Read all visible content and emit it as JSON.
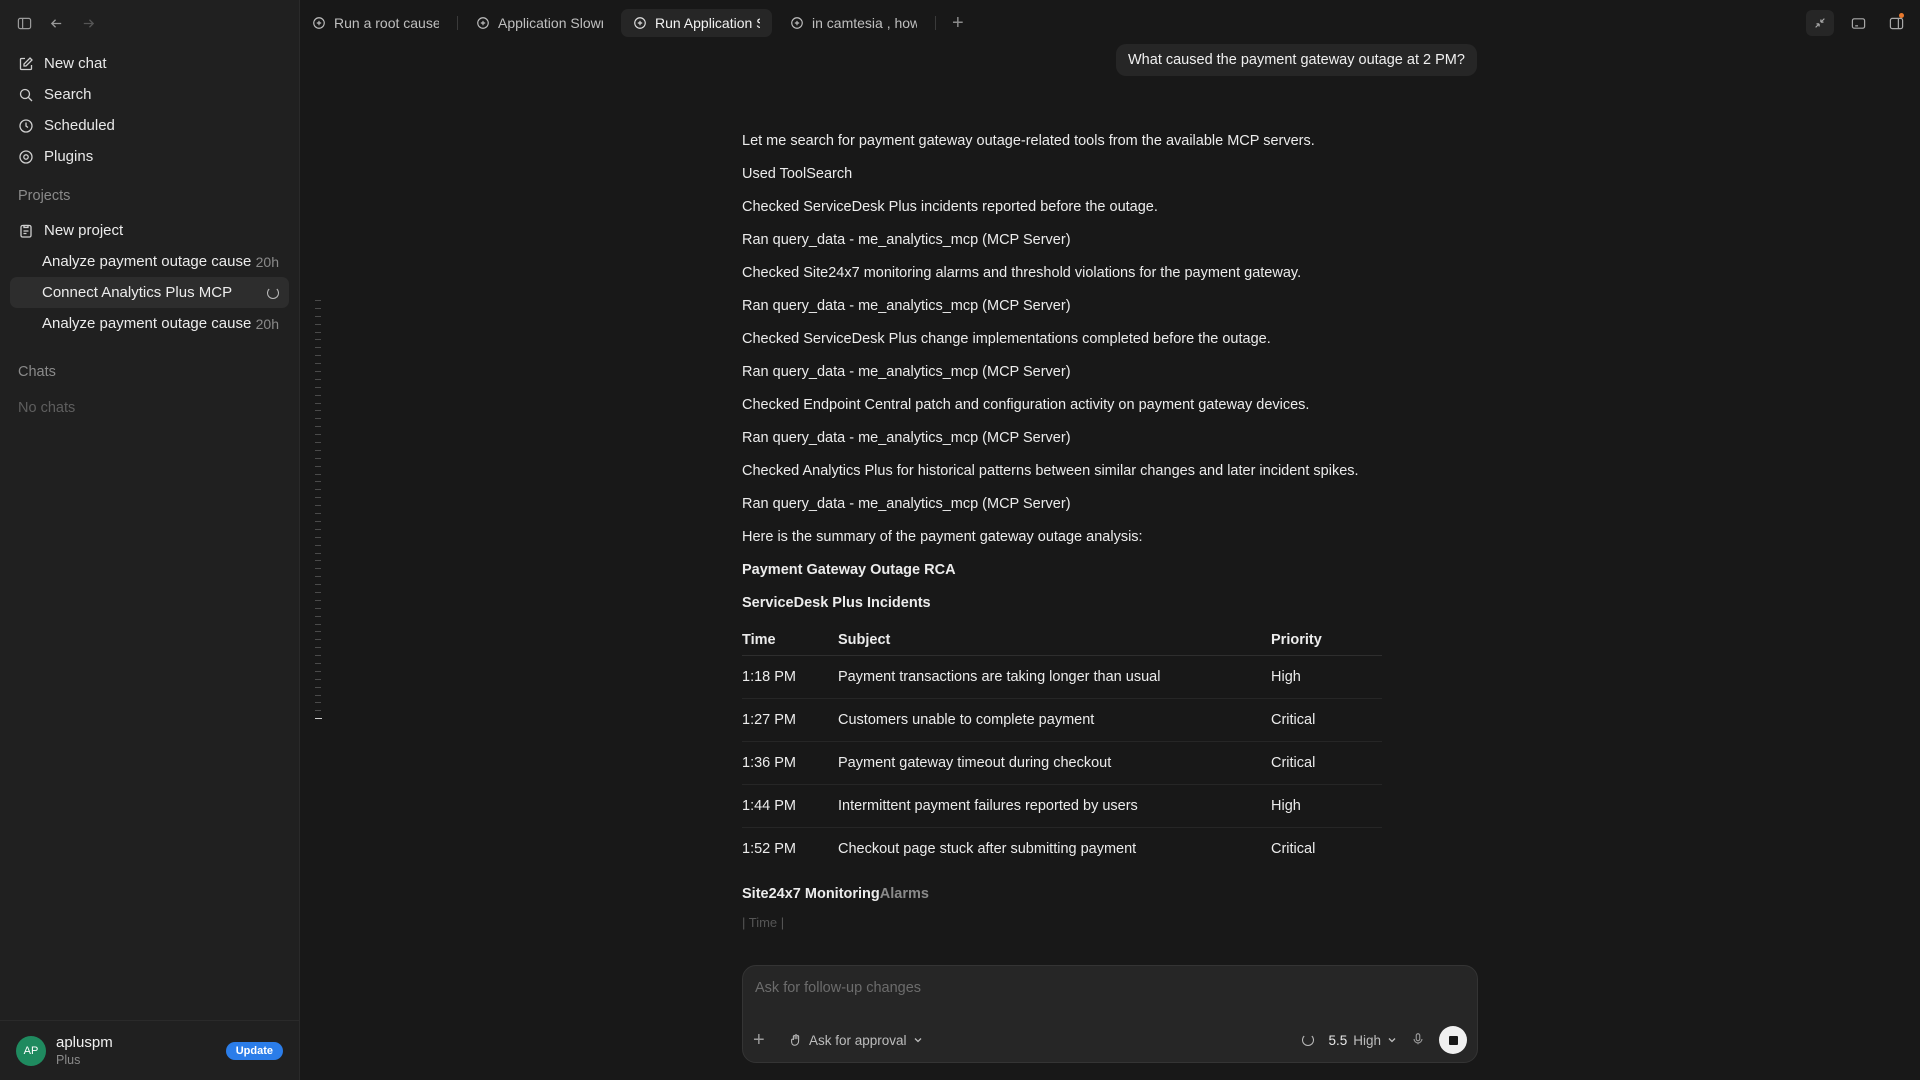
{
  "sidebar": {
    "nav": [
      {
        "label": "New chat",
        "icon": "edit-icon"
      },
      {
        "label": "Search",
        "icon": "search-icon"
      },
      {
        "label": "Scheduled",
        "icon": "clock-icon"
      },
      {
        "label": "Plugins",
        "icon": "plugin-icon"
      }
    ],
    "projects_label": "Projects",
    "new_project": "New project",
    "projects": [
      {
        "label": "Analyze payment outage cause",
        "age": "20h"
      },
      {
        "label": "Connect Analytics Plus MCP",
        "age": ""
      },
      {
        "label": "Analyze payment outage cause",
        "age": "20h"
      }
    ],
    "chats_label": "Chats",
    "no_chats": "No chats",
    "user": {
      "initials": "AP",
      "name": "apluspm",
      "plan": "Plus",
      "update_label": "Update"
    }
  },
  "tabs": [
    {
      "label": "Run a root cause"
    },
    {
      "label": "Application Slowr"
    },
    {
      "label": "Run Application S"
    },
    {
      "label": "in camtesia , how"
    }
  ],
  "user_message": "What caused the payment gateway outage at 2 PM?",
  "assistant": {
    "lines": [
      "Let me search for payment gateway outage-related tools from the available MCP servers.",
      "Used ToolSearch",
      "Checked ServiceDesk Plus incidents reported before the outage.",
      "Ran query_data - me_analytics_mcp (MCP Server)",
      "Checked Site24x7 monitoring alarms and threshold violations for the payment gateway.",
      "Ran query_data - me_analytics_mcp (MCP Server)",
      "Checked ServiceDesk Plus change implementations completed before the outage.",
      "Ran query_data - me_analytics_mcp (MCP Server)",
      "Checked Endpoint Central patch and configuration activity on payment gateway devices.",
      "Ran query_data - me_analytics_mcp (MCP Server)",
      "Checked Analytics Plus for historical patterns between similar changes and later incident spikes.",
      "Ran query_data - me_analytics_mcp (MCP Server)",
      "Here is the summary of the payment gateway outage analysis:"
    ],
    "rca_title": "Payment Gateway Outage RCA",
    "sdp_title": "ServiceDesk Plus Incidents",
    "table": {
      "headers": [
        "Time",
        "Subject",
        "Priority"
      ],
      "rows": [
        [
          "1:18 PM",
          "Payment transactions are taking longer than usual",
          "High"
        ],
        [
          "1:27 PM",
          "Customers unable to complete payment",
          "Critical"
        ],
        [
          "1:36 PM",
          "Payment gateway timeout during checkout",
          "Critical"
        ],
        [
          "1:44 PM",
          "Intermittent payment failures reported by users",
          "High"
        ],
        [
          "1:52 PM",
          "Checkout page stuck after submitting payment",
          "Critical"
        ]
      ]
    },
    "site_title_a": "Site24x7 Monitoring",
    "site_title_b": " Alarms",
    "partial_row": "| Time |"
  },
  "composer": {
    "placeholder": "Ask for follow-up changes",
    "approval_label": "Ask for approval",
    "model_version": "5.5",
    "model_level": "High"
  }
}
